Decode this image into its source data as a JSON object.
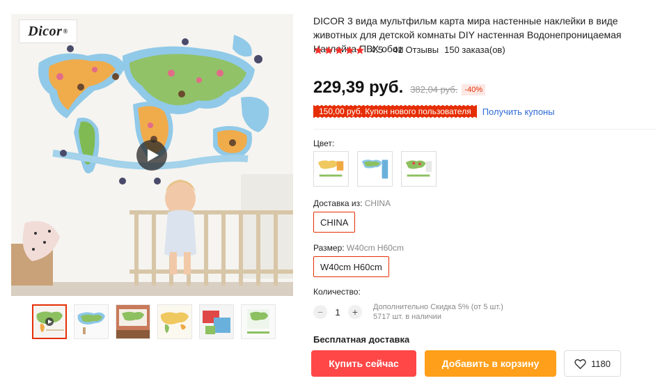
{
  "gallery": {
    "logo_text": "Dicor",
    "logo_mark": "®",
    "play_icon": "play-icon",
    "thumbnail_count": 6
  },
  "product": {
    "title": "DICOR 3 вида мультфильм карта мира настенные наклейки в виде животных для детской комнаты DIY настенная Водонепроницаемая Наклейка ПВХ обои",
    "rating": "4.5",
    "stars_filled": 5,
    "reviews": "41 Отзывы",
    "orders": "150 заказа(ов)",
    "price": "229,39 руб.",
    "old_price": "382,04 руб.",
    "discount": "-40%",
    "coupon": "150,00 руб. Купон нового пользователя",
    "coupon_link": "Получить купоны"
  },
  "options": {
    "color_label": "Цвет:",
    "ship_from_label": "Доставка из:",
    "ship_from_value": "CHINA",
    "ship_from_selected": "CHINA",
    "size_label": "Размер:",
    "size_value": "W40cm H60cm",
    "size_selected": "W40cm H60cm"
  },
  "quantity": {
    "label": "Количество:",
    "value": "1",
    "minus": "−",
    "plus": "+",
    "discount_note": "Дополнительно Скидка 5% (от 5 шт.)",
    "stock": "5717 шт. в наличии"
  },
  "shipping": {
    "text": "Бесплатная доставка"
  },
  "actions": {
    "buy": "Купить сейчас",
    "cart": "Добавить в корзину",
    "wishlist_count": "1180"
  },
  "colors": {
    "accent": "#e62e04",
    "buy_button": "#ff4747",
    "cart_button": "#ff9f1a",
    "star": "#f5322d",
    "link": "#2e6bd6"
  }
}
